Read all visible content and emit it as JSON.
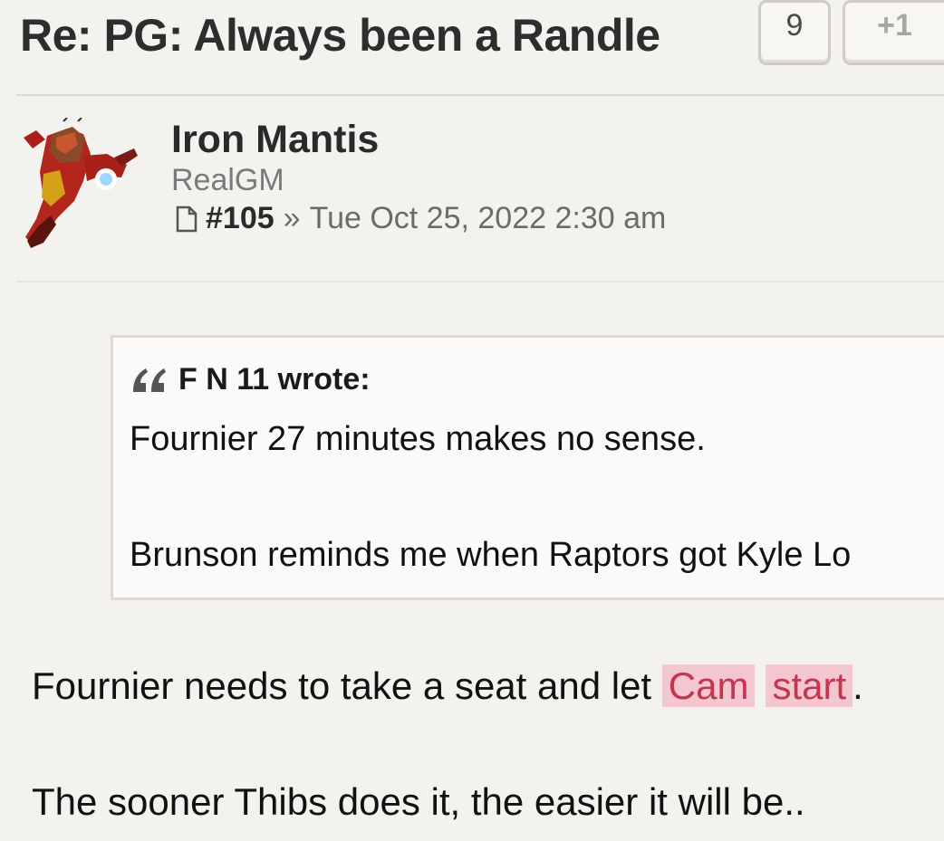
{
  "post": {
    "title": "Re: PG: Always been a Randle",
    "count": "9",
    "plus_label": "+1"
  },
  "author": {
    "name": "Iron Mantis",
    "rank": "RealGM",
    "avatar_icon": "iron-man-mantis-avatar"
  },
  "meta": {
    "post_number": "#105",
    "separator": "»",
    "date": "Tue Oct 25, 2022 2:30 am",
    "icon": "document-icon"
  },
  "quote": {
    "author_line": "F N 11 wrote:",
    "lines": [
      "Fournier 27 minutes makes no sense.",
      "Brunson reminds me when Raptors got Kyle Lo"
    ],
    "icon": "quote-icon"
  },
  "body": {
    "line1_prefix": "Fournier needs to take a seat and let ",
    "highlight_words": [
      "Cam",
      "start"
    ],
    "line1_suffix": ".",
    "line2": "The sooner Thibs does it, the easier it will be.."
  },
  "colors": {
    "background": "#f4f2ee",
    "highlight_bg": "#f4c6cf",
    "highlight_text": "#c2364f"
  }
}
